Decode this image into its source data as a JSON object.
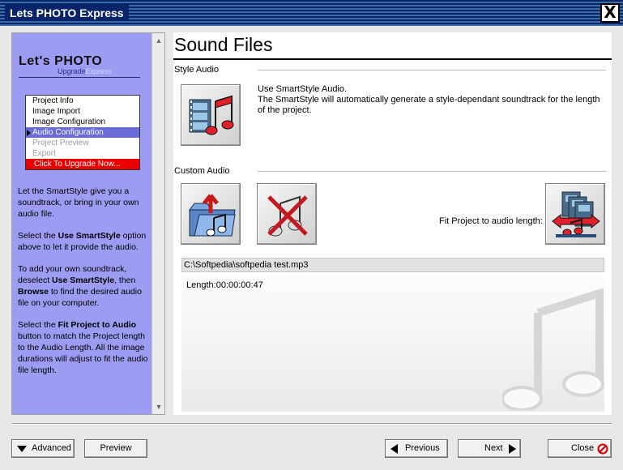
{
  "window": {
    "title": "Lets PHOTO Express",
    "close_glyph": "X"
  },
  "logo": {
    "main": "Let's PHOTO",
    "sub_a": "Upgrade",
    "sub_b": "Express"
  },
  "nav": {
    "items": [
      {
        "label": "Project Info",
        "state": "normal"
      },
      {
        "label": "Image Import",
        "state": "normal"
      },
      {
        "label": "Image Configuration",
        "state": "normal"
      },
      {
        "label": "Audio Configuration",
        "state": "active"
      },
      {
        "label": "Project Preview",
        "state": "disabled"
      },
      {
        "label": "Export",
        "state": "disabled"
      },
      {
        "label": "Click To Upgrade Now...",
        "state": "upgrade"
      }
    ]
  },
  "help": {
    "p1": "Let the SmartStyle give you a soundtrack, or bring in your own audio file.",
    "p2_pre": "Select the ",
    "p2_bold": "Use SmartStyle",
    "p2_post": " option above to let it provide the audio.",
    "p3_pre": "To add your own soundtrack, deselect ",
    "p3_bold1": "Use SmartStyle",
    "p3_mid": ", then ",
    "p3_bold2": "Browse",
    "p3_post": " to find the desired audio file on your computer.",
    "p4_pre": "Select the ",
    "p4_bold": "Fit Project to Audio",
    "p4_post": " button to match the Project length to the Audio Length. All the image durations will adjust to fit the audio file length."
  },
  "main": {
    "title": "Sound Files",
    "style_audio_label": "Style Audio",
    "smartstyle_line1": "Use SmartStyle Audio.",
    "smartstyle_line2": "The SmartStyle will automatically generate a style-dependant soundtrack for the length of the project.",
    "custom_audio_label": "Custom Audio",
    "fit_label": "Fit Project to audio length:",
    "audio_path": "C:\\Softpedia\\softpedia test.mp3",
    "length": "Length:00:00:00:47"
  },
  "footer": {
    "advanced": "Advanced",
    "preview": "Preview",
    "previous": "Previous",
    "next": "Next",
    "close": "Close"
  },
  "colors": {
    "title_bar": "#0a246a",
    "left_panel": "#9b9cf2",
    "nav_active": "#6b6cd8",
    "upgrade": "#e80000",
    "note_red": "#e0202a"
  },
  "icons": [
    "smartstyle-audio-icon",
    "browse-audio-icon",
    "remove-audio-icon",
    "fit-to-audio-icon",
    "music-note-watermark-icon",
    "close-red-icon"
  ]
}
